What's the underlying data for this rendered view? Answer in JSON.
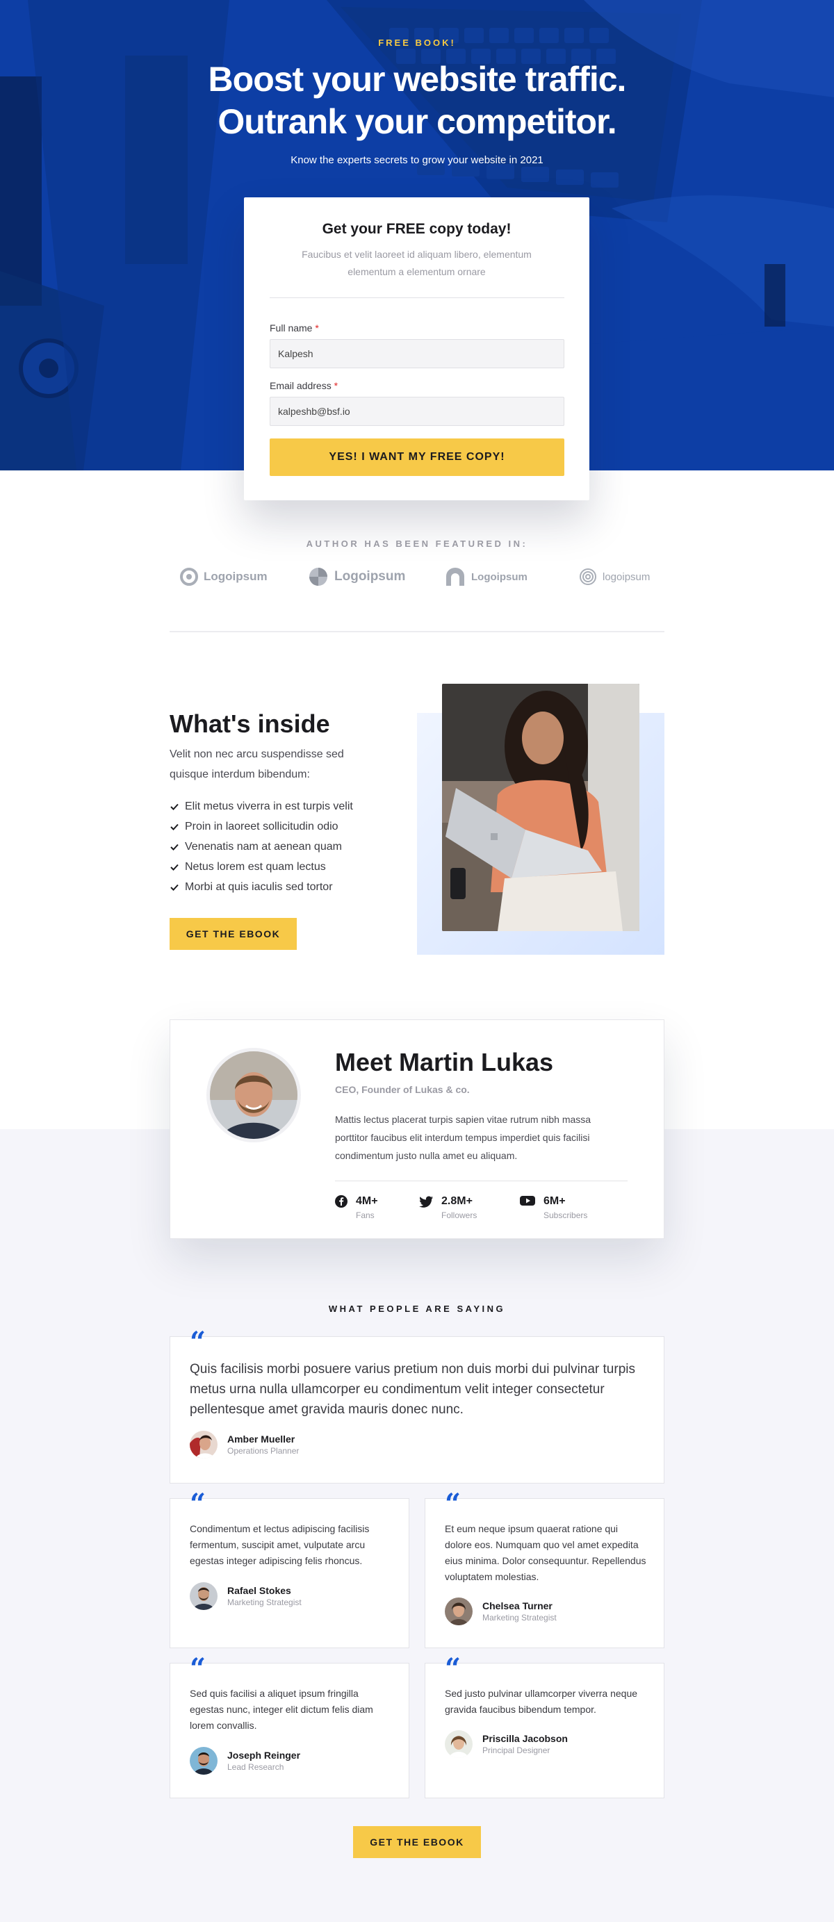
{
  "hero": {
    "eyebrow": "FREE BOOK!",
    "title_line1": "Boost your website traffic.",
    "title_line2": "Outrank your competitor.",
    "subtitle": "Know the experts secrets to grow your website in 2021"
  },
  "form": {
    "title": "Get your FREE copy today!",
    "description": "Faucibus et velit laoreet id aliquam libero, elementum elementum a elementum ornare",
    "name_label": "Full name",
    "name_value": "Kalpesh",
    "email_label": "Email address",
    "email_value": "kalpeshb@bsf.io",
    "required_mark": "*",
    "submit_label": "YES! I WANT MY FREE COPY!"
  },
  "featured": {
    "label": "AUTHOR HAS BEEN FEATURED IN:",
    "logos": [
      "Logoipsum",
      "Logoipsum",
      "Logoipsum",
      "logoipsum"
    ]
  },
  "inside": {
    "title": "What's inside",
    "description": "Velit non nec arcu suspendisse sed quisque interdum bibendum:",
    "items": [
      "Elit metus viverra in est turpis velit",
      "Proin in laoreet sollicitudin odio",
      "Venenatis nam at aenean quam",
      "Netus lorem est quam lectus",
      "Morbi at quis iaculis sed tortor"
    ],
    "button_label": "GET THE EBOOK"
  },
  "author": {
    "title": "Meet Martin Lukas",
    "role": "CEO, Founder of Lukas & co.",
    "bio": "Mattis lectus placerat turpis sapien vitae rutrum nibh massa porttitor faucibus elit interdum tempus imperdiet quis facilisi condimentum justo nulla amet eu aliquam.",
    "stats": [
      {
        "icon": "facebook-icon",
        "value": "4M+",
        "label": "Fans"
      },
      {
        "icon": "twitter-icon",
        "value": "2.8M+",
        "label": "Followers"
      },
      {
        "icon": "youtube-icon",
        "value": "6M+",
        "label": "Subscribers"
      }
    ]
  },
  "testimonials": {
    "heading": "WHAT PEOPLE ARE SAYING",
    "items": [
      {
        "quote": "Quis facilisis morbi posuere varius pretium non duis morbi dui pulvinar turpis metus urna nulla ullamcorper eu condimentum velit integer consectetur pellentesque amet gravida mauris donec nunc.",
        "name": "Amber Mueller",
        "role": "Operations Planner"
      },
      {
        "quote": "Condimentum et lectus adipiscing facilisis fermentum, suscipit amet, vulputate arcu egestas integer adipiscing felis rhoncus.",
        "name": "Rafael Stokes",
        "role": "Marketing Strategist"
      },
      {
        "quote": "Et eum neque ipsum quaerat ratione qui dolore eos. Numquam quo vel amet expedita eius minima. Dolor consequuntur. Repellendus voluptatem molestias.",
        "name": "Chelsea Turner",
        "role": "Marketing Strategist"
      },
      {
        "quote": "Sed quis facilisi a aliquet ipsum fringilla egestas nunc, integer elit dictum felis diam lorem convallis.",
        "name": "Joseph Reinger",
        "role": "Lead Research"
      },
      {
        "quote": "Sed justo pulvinar ullamcorper viverra neque gravida faucibus bibendum tempor.",
        "name": "Priscilla Jacobson",
        "role": "Principal Designer"
      }
    ],
    "button_label": "GET THE EBOOK"
  },
  "colors": {
    "hero_blue": "#0d3ea5",
    "accent_yellow": "#f7c948",
    "quote_blue": "#1a5cd6",
    "page_bg": "#f5f5fa"
  }
}
